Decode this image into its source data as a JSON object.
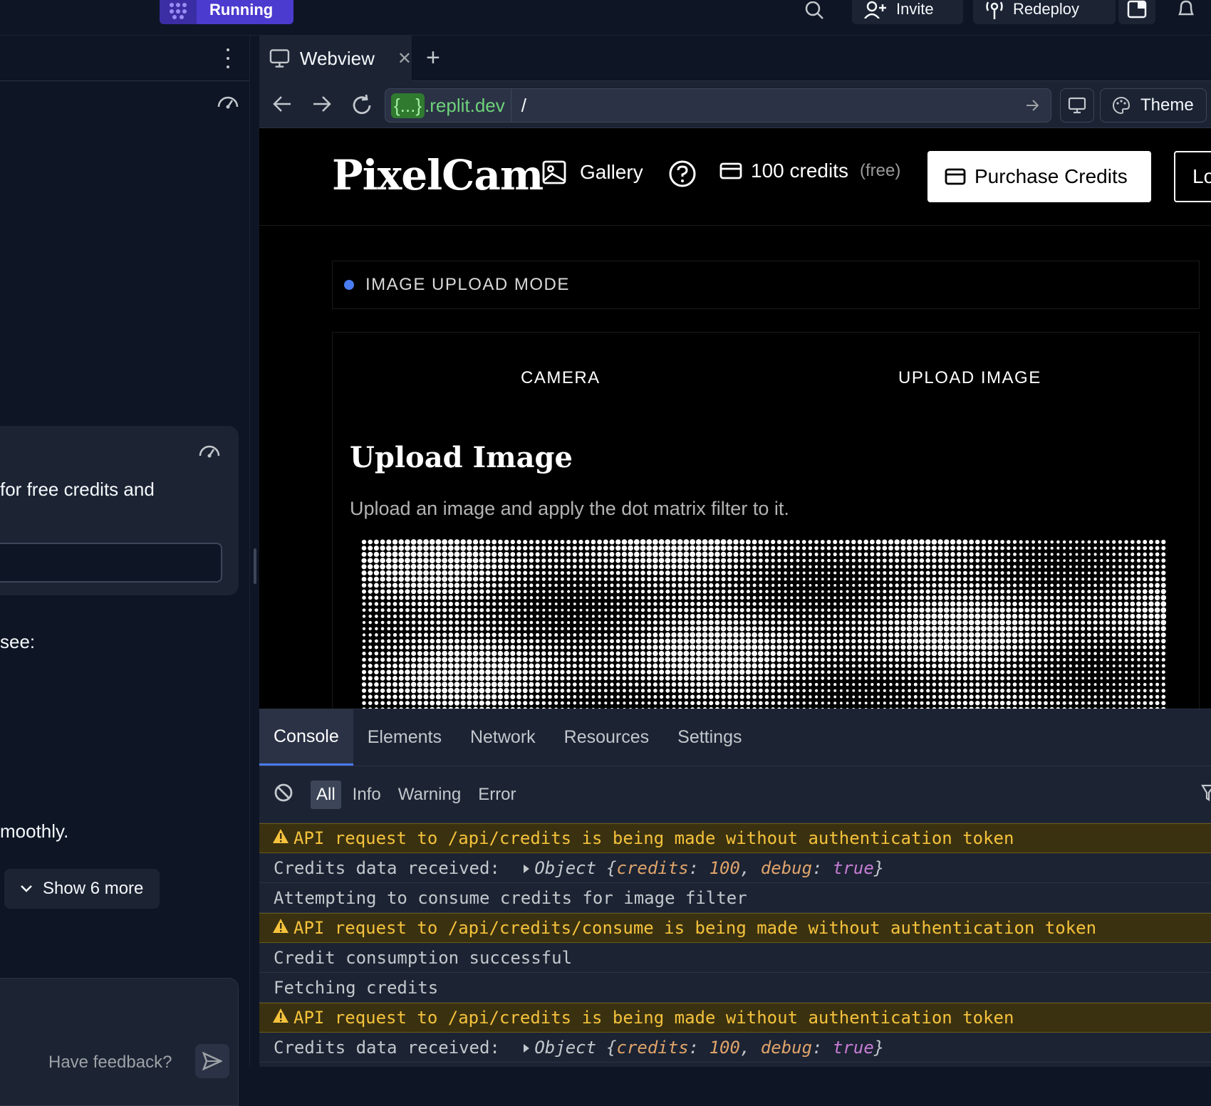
{
  "topbar": {
    "run_label": "Running",
    "invite_label": "Invite",
    "redeploy_label": "Redeploy"
  },
  "left_panel": {
    "card_text": "for free credits and",
    "see_text": "see:",
    "smoothly_text": "moothly.",
    "show_more_label": "Show 6 more",
    "feedback_label": "Have feedback?"
  },
  "webview": {
    "tab_label": "Webview",
    "url_host_prefix": "{...}",
    "url_host": ".replit.dev",
    "url_path": "/",
    "theme_label": "Theme"
  },
  "site": {
    "logo": "PixelCam",
    "gallery_label": "Gallery",
    "credits_label": "100 credits",
    "credits_note": "(free)",
    "purchase_label": "Purchase Credits",
    "login_label": "Lo",
    "mode_label": "IMAGE UPLOAD MODE",
    "tab_camera": "CAMERA",
    "tab_upload": "UPLOAD IMAGE",
    "upload_title": "Upload Image",
    "upload_desc": "Upload an image and apply the dot matrix filter to it."
  },
  "devtools": {
    "tabs": [
      "Console",
      "Elements",
      "Network",
      "Resources",
      "Settings"
    ],
    "filters": [
      "All",
      "Info",
      "Warning",
      "Error"
    ],
    "logs": [
      {
        "type": "warn",
        "text": "API request to /api/credits is being made without authentication token"
      },
      {
        "type": "obj",
        "text": "Credits data received: ",
        "obj_label": "Object",
        "obj_open": "{",
        "k1": "credits",
        "v1": "100",
        "k2": "debug",
        "v2": "true",
        "obj_close": "}"
      },
      {
        "type": "log",
        "text": "Attempting to consume credits for image filter"
      },
      {
        "type": "warn",
        "text": "API request to /api/credits/consume is being made without authentication token"
      },
      {
        "type": "log",
        "text": "Credit consumption successful"
      },
      {
        "type": "log",
        "text": "Fetching credits"
      },
      {
        "type": "warn",
        "text": "API request to /api/credits is being made without authentication token"
      },
      {
        "type": "obj",
        "text": "Credits data received: ",
        "obj_label": "Object",
        "obj_open": "{",
        "k1": "credits",
        "v1": "100",
        "k2": "debug",
        "v2": "true",
        "obj_close": "}"
      }
    ]
  },
  "colors": {
    "accent": "#4c3bcf",
    "warning_bg": "#3a3110",
    "warning_text": "#f5c23c",
    "mode_dot": "#4a7cf4",
    "url_host": "#6ed37a"
  }
}
